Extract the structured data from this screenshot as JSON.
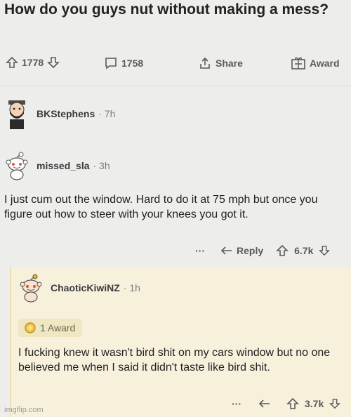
{
  "post": {
    "title": "How do you guys nut without making a mess?",
    "upvotes": "1778",
    "comments": "1758",
    "share_label": "Share",
    "award_label": "Award"
  },
  "comments": [
    {
      "user": "BKStephens",
      "age": "· 7h",
      "avatar_icon": "bearded-avatar-icon"
    },
    {
      "user": "missed_sla",
      "age": "· 3h",
      "avatar_icon": "snoo-avatar-icon",
      "body": "I just cum out the window. Hard to do it at 75 mph but once you figure out how to steer with your knees you got it.",
      "more": "···",
      "reply_label": "Reply",
      "score": "6.7k"
    },
    {
      "user": "ChaoticKiwiNZ",
      "age": "· 1h",
      "avatar_icon": "snoo-avatar-icon",
      "award_text": "1 Award",
      "body": "I fucking knew it wasn't bird shit on my cars window but no one believed me when I said it didn't taste like bird shit.",
      "more": "···",
      "score": "3.7k"
    }
  ],
  "watermark": "imgflip.com",
  "colors": {
    "reply_bg": "#f7f1dc",
    "award_pill": "#efe6c2",
    "muted": "#787c7e"
  }
}
